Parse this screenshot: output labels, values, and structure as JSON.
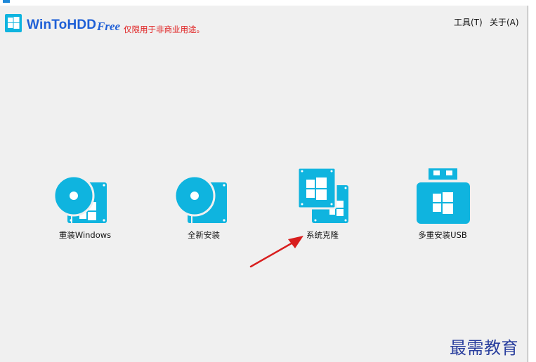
{
  "app": {
    "name": "WinToHDD",
    "edition": "Free",
    "notice": "仅限用于非商业用途。"
  },
  "menu": {
    "tools": "工具(T)",
    "about": "关于(A)"
  },
  "tiles": [
    {
      "label": "重装Windows",
      "icon": "disc-windows-icon"
    },
    {
      "label": "全新安装",
      "icon": "disc-drive-icon"
    },
    {
      "label": "系统克隆",
      "icon": "clone-windows-icon"
    },
    {
      "label": "多重安装USB",
      "icon": "usb-windows-icon"
    }
  ],
  "watermark": "最需教育",
  "colors": {
    "accent": "#0fb4df",
    "brand_blue": "#1e5fd6",
    "notice_red": "#e02020",
    "arrow_red": "#d81e1e",
    "background": "#f0f0f0"
  }
}
